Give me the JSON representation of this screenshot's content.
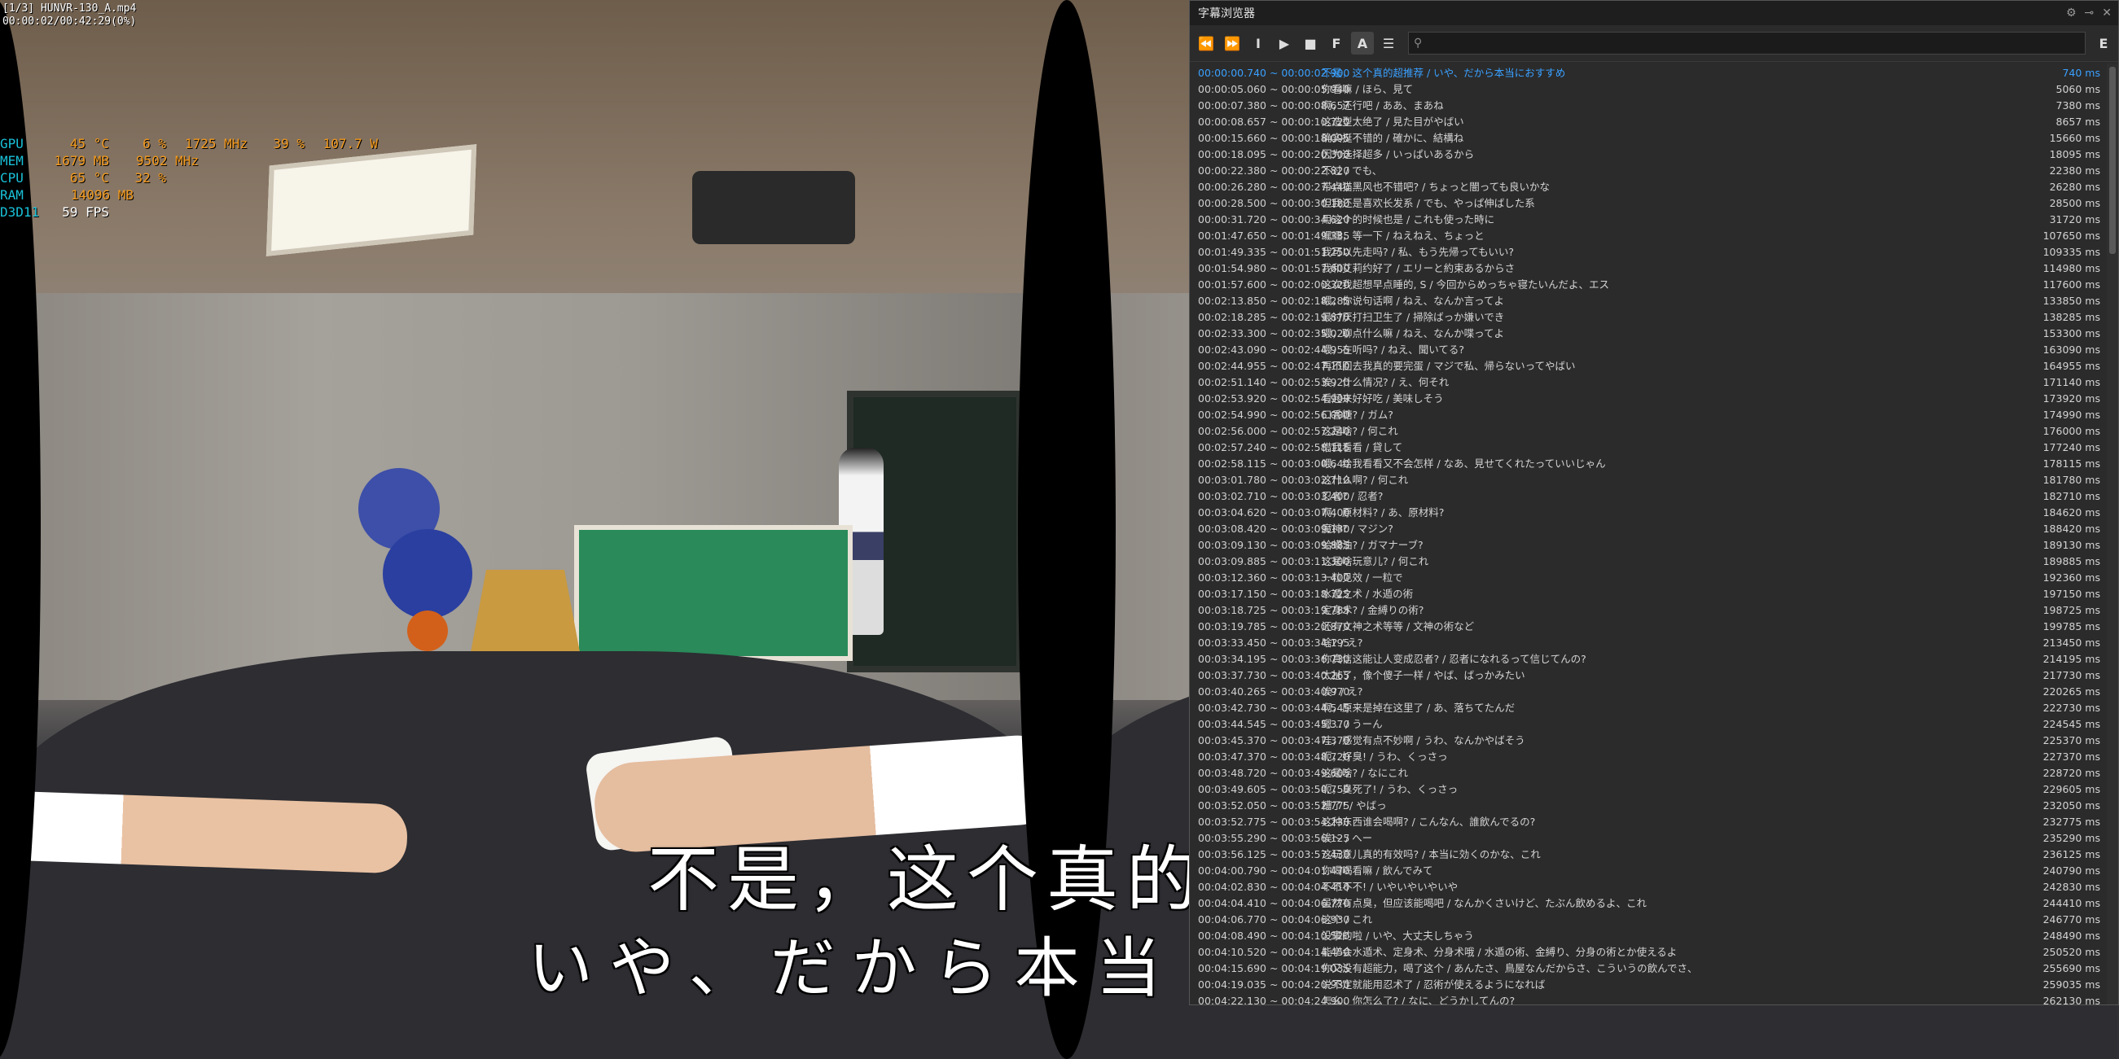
{
  "osd": {
    "file": "[1/3] HUNVR-130_A.mp4",
    "time": "00:00:02/00:42:29(0%)"
  },
  "hw": [
    {
      "label": "GPU",
      "cells": [
        "45 °C",
        "6 %",
        "1725 MHz",
        "39 %",
        "107.7 W"
      ]
    },
    {
      "label": "MEM",
      "cells": [
        "1679 MB",
        "9502 MHz"
      ]
    },
    {
      "label": "CPU",
      "cells": [
        "65 °C",
        "32 %"
      ]
    },
    {
      "label": "RAM",
      "cells": [
        "14096 MB"
      ]
    },
    {
      "label": "D3D11",
      "cells": [
        "59 FPS"
      ]
    }
  ],
  "subtitle": {
    "cn": "不是，这个真的",
    "jp": "いや、だから本当"
  },
  "panel": {
    "title": "字幕浏览器",
    "search_placeholder": "",
    "e_label": "E",
    "rows": [
      {
        "t": "00:00:00.740 ~ 00:00:02.900",
        "x": "不是，这个真的超推荐 / いや、だから本当におすすめ",
        "ms": "740 ms"
      },
      {
        "t": "00:00:05.060 ~ 00:00:05.940",
        "x": "你看嘛 / ほら、見て",
        "ms": "5060 ms"
      },
      {
        "t": "00:00:07.380 ~ 00:00:08.657",
        "x": "啊，还行吧 / ああ、まあね",
        "ms": "7380 ms"
      },
      {
        "t": "00:00:08.657 ~ 00:00:10.720",
        "x": "这造型太绝了 / 見た目がやばい",
        "ms": "8657 ms"
      },
      {
        "t": "00:00:15.660 ~ 00:00:18.095",
        "x": "确实挺不错的 / 確かに、結構ね",
        "ms": "15660 ms"
      },
      {
        "t": "00:00:18.095 ~ 00:00:20.300",
        "x": "因为选择超多 / いっぱいあるから",
        "ms": "18095 ms"
      },
      {
        "t": "00:00:22.380 ~ 00:00:22.820",
        "x": "不过 / でも、",
        "ms": "22380 ms"
      },
      {
        "t": "00:00:26.280 ~ 00:00:27.440",
        "x": "带点猫黑风也不错吧? / ちょっと闇っても良いかな",
        "ms": "26280 ms"
      },
      {
        "t": "00:00:28.500 ~ 00:00:30.180",
        "x": "但我还是喜欢长发系 / でも、やっぱ伸ばした系",
        "ms": "28500 ms"
      },
      {
        "t": "00:00:31.720 ~ 00:00:34.620",
        "x": "用这个的时候也是 / これも使った時に",
        "ms": "31720 ms"
      },
      {
        "t": "00:01:47.650 ~ 00:01:49.335",
        "x": "嘿嘿，等一下 / ねえねえ、ちょっと",
        "ms": "107650 ms"
      },
      {
        "t": "00:01:49.335 ~ 00:01:51.250",
        "x": "我可以先走吗? / 私、もう先帰ってもいい?",
        "ms": "109335 ms"
      },
      {
        "t": "00:01:54.980 ~ 00:01:57.600",
        "x": "我和艾莉约好了 / エリーと約束あるからさ",
        "ms": "114980 ms"
      },
      {
        "t": "00:01:57.600 ~ 00:02:00.320",
        "x": "这次我超想早点睡的, S / 今回からめっちゃ寝たいんだよ、エス",
        "ms": "117600 ms"
      },
      {
        "t": "00:02:13.850 ~ 00:02:18.285",
        "x": "喂，你说句话啊 / ねえ、なんか言ってよ",
        "ms": "133850 ms"
      },
      {
        "t": "00:02:18.285 ~ 00:02:19.870",
        "x": "最讨厌打扫卫生了 / 掃除ばっか嫌いでき",
        "ms": "138285 ms"
      },
      {
        "t": "00:02:33.300 ~ 00:02:35.020",
        "x": "喂，聊点什么嘛 / ねえ、なんか喋ってよ",
        "ms": "153300 ms"
      },
      {
        "t": "00:02:43.090 ~ 00:02:44.955",
        "x": "喂，在听吗? / ねえ、聞いてる?",
        "ms": "163090 ms"
      },
      {
        "t": "00:02:44.955 ~ 00:02:47.110",
        "x": "再不回去我真的要完蛋 / マジで私、帰らないってやばい",
        "ms": "164955 ms"
      },
      {
        "t": "00:02:51.140 ~ 00:02:53.920",
        "x": "诶，什么情况? / え、何それ",
        "ms": "171140 ms"
      },
      {
        "t": "00:02:53.920 ~ 00:02:54.990",
        "x": "看起来好好吃 / 美味しそう",
        "ms": "173920 ms"
      },
      {
        "t": "00:02:54.990 ~ 00:02:56.000",
        "x": "口香糖? / ガム?",
        "ms": "174990 ms"
      },
      {
        "t": "00:02:56.000 ~ 00:02:57.240",
        "x": "这是啥? / 何これ",
        "ms": "176000 ms"
      },
      {
        "t": "00:02:57.240 ~ 00:02:58.115",
        "x": "借我看看 / 貸して",
        "ms": "177240 ms"
      },
      {
        "t": "00:02:58.115 ~ 00:03:00.640",
        "x": "喂，给我看看又不会怎样 / なあ、見せてくれたっていいじゃん",
        "ms": "178115 ms"
      },
      {
        "t": "00:03:01.780 ~ 00:03:02.710",
        "x": "这什么啊? / 何これ",
        "ms": "181780 ms"
      },
      {
        "t": "00:03:02.710 ~ 00:03:03.400",
        "x": "忍者? / 忍者?",
        "ms": "182710 ms"
      },
      {
        "t": "00:03:04.620 ~ 00:03:07.400",
        "x": "啊，原材料? / あ、原材料?",
        "ms": "184620 ms"
      },
      {
        "t": "00:03:08.420 ~ 00:03:09.130",
        "x": "魔神? / マジン?",
        "ms": "188420 ms"
      },
      {
        "t": "00:03:09.130 ~ 00:03:09.885",
        "x": "蛤蟆油? / ガマナーブ?",
        "ms": "189130 ms"
      },
      {
        "t": "00:03:09.885 ~ 00:03:11.300",
        "x": "这是啥玩意儿? / 何これ",
        "ms": "189885 ms"
      },
      {
        "t": "00:03:12.360 ~ 00:03:13.400",
        "x": "一粒见效 / 一粒で",
        "ms": "192360 ms"
      },
      {
        "t": "00:03:17.150 ~ 00:03:18.725",
        "x": "水遁之术 / 水遁の術",
        "ms": "197150 ms"
      },
      {
        "t": "00:03:18.725 ~ 00:03:19.785",
        "x": "定身术? / 金縛りの術?",
        "ms": "198725 ms"
      },
      {
        "t": "00:03:19.785 ~ 00:03:20.870",
        "x": "还有文神之术等等 / 文神の術など",
        "ms": "199785 ms"
      },
      {
        "t": "00:03:33.450 ~ 00:03:34.195",
        "x": "啥? / え?",
        "ms": "213450 ms"
      },
      {
        "t": "00:03:34.195 ~ 00:03:36.730",
        "x": "你真信这能让人变成忍者? / 忍者になれるって信じてんの?",
        "ms": "214195 ms"
      },
      {
        "t": "00:03:37.730 ~ 00:03:40.265",
        "x": "太扯了，像个傻子一样 / やば、ばっかみたい",
        "ms": "217730 ms"
      },
      {
        "t": "00:03:40.265 ~ 00:03:40.970",
        "x": "诶? / え?",
        "ms": "220265 ms"
      },
      {
        "t": "00:03:42.730 ~ 00:03:44.545",
        "x": "啊，原来是掉在这里了 / あ、落ちてたんだ",
        "ms": "222730 ms"
      },
      {
        "t": "00:03:44.545 ~ 00:03:45.370",
        "x": "嗯… / うーん",
        "ms": "224545 ms"
      },
      {
        "t": "00:03:45.370 ~ 00:03:47.370",
        "x": "哇，感觉有点不妙啊 / うわ、なんかやばそう",
        "ms": "225370 ms"
      },
      {
        "t": "00:03:47.370 ~ 00:03:48.720",
        "x": "呃，好臭! / うわ、くっさっ",
        "ms": "227370 ms"
      },
      {
        "t": "00:03:48.720 ~ 00:03:49.605",
        "x": "这是啥? / なにこれ",
        "ms": "228720 ms"
      },
      {
        "t": "00:03:49.605 ~ 00:03:50.750",
        "x": "呃，臭死了! / うわ、くっさっ",
        "ms": "229605 ms"
      },
      {
        "t": "00:03:52.050 ~ 00:03:52.775",
        "x": "糟了! / やばっ",
        "ms": "232050 ms"
      },
      {
        "t": "00:03:52.775 ~ 00:03:54.230",
        "x": "这种东西谁会喝啊? / こんなん、誰飲んでるの?",
        "ms": "232775 ms"
      },
      {
        "t": "00:03:55.290 ~ 00:03:56.125",
        "x": "诶～ / へー",
        "ms": "235290 ms"
      },
      {
        "t": "00:03:56.125 ~ 00:03:57.430",
        "x": "这玩意儿真的有效吗? / 本当に効くのかな、これ",
        "ms": "236125 ms"
      },
      {
        "t": "00:04:00.790 ~ 00:04:01.470",
        "x": "你喝喝看嘛 / 飲んでみて",
        "ms": "240790 ms"
      },
      {
        "t": "00:04:02.830 ~ 00:04:04.410",
        "x": "不不不不! / いやいやいやいや",
        "ms": "242830 ms"
      },
      {
        "t": "00:04:04.410 ~ 00:04:06.770",
        "x": "虽然有点臭，但应该能喝吧 / なんかくさいけど、たぶん飲めるよ、これ",
        "ms": "244410 ms"
      },
      {
        "t": "00:04:06.770 ~ 00:04:06.930",
        "x": "这个 / これ",
        "ms": "246770 ms"
      },
      {
        "t": "00:04:08.490 ~ 00:04:10.520",
        "x": "没事的啦 / いや、大丈夫しちゃう",
        "ms": "248490 ms"
      },
      {
        "t": "00:04:10.520 ~ 00:04:14.450",
        "x": "能学会水遁术、定身术、分身术哦 / 水遁の術、金縛り、分身の術とか使えるよ",
        "ms": "250520 ms"
      },
      {
        "t": "00:04:15.690 ~ 00:04:19.035",
        "x": "你又没有超能力，喝了这个 / あんたさ、鳥屋なんだからさ、こういうの飲んでさ、",
        "ms": "255690 ms"
      },
      {
        "t": "00:04:19.035 ~ 00:04:20.930",
        "x": "说不定就能用忍术了 / 忍術が使えるようになれば",
        "ms": "259035 ms"
      },
      {
        "t": "00:04:22.130 ~ 00:04:24.900",
        "x": "怎么，你怎么了? / なに、どうかしてんの?",
        "ms": "262130 ms"
      }
    ]
  }
}
